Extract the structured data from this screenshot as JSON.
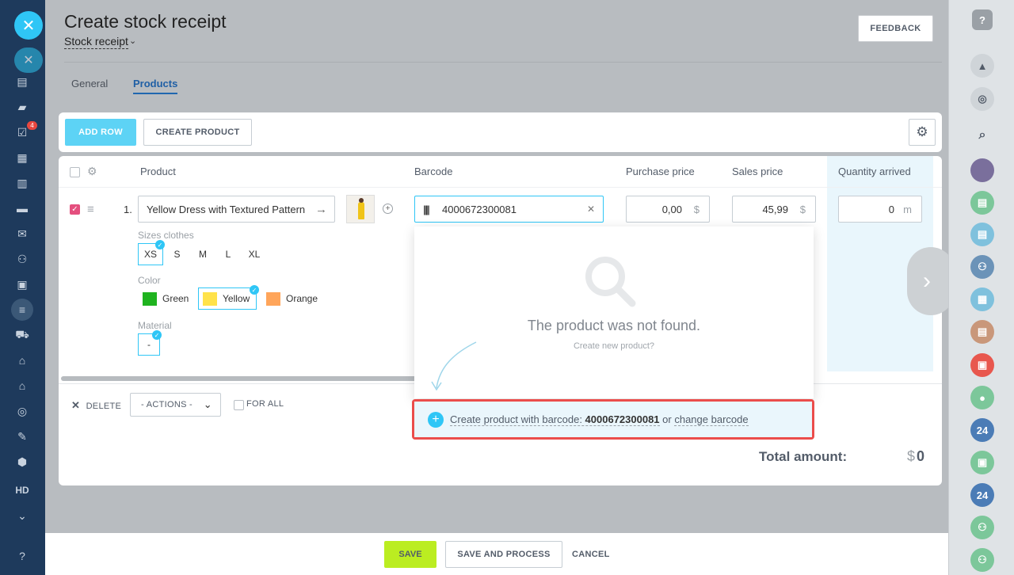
{
  "page": {
    "title": "Create stock receipt",
    "subtitle": "Stock receipt",
    "feedback_label": "FEEDBACK"
  },
  "tabs": [
    {
      "label": "General"
    },
    {
      "label": "Products"
    }
  ],
  "toolbar": {
    "add_row": "ADD ROW",
    "create_product": "CREATE PRODUCT"
  },
  "table": {
    "headers": [
      "Product",
      "Barcode",
      "Purchase price",
      "Sales price",
      "Quantity arrived"
    ],
    "row": {
      "number": "1.",
      "product": "Yellow Dress with Textured Pattern",
      "barcode": "4000672300081",
      "purchase_price": "0,00",
      "purchase_currency": "$",
      "sales_price": "45,99",
      "sales_currency": "$",
      "quantity": "0",
      "quantity_unit": "m"
    },
    "properties": {
      "sizes_label": "Sizes clothes",
      "sizes": [
        "XS",
        "S",
        "M",
        "L",
        "XL"
      ],
      "selected_size": "XS",
      "color_label": "Color",
      "colors": [
        {
          "name": "Green",
          "hex": "#1fb31f"
        },
        {
          "name": "Yellow",
          "hex": "#ffe24a"
        },
        {
          "name": "Orange",
          "hex": "#ffa55a"
        }
      ],
      "selected_color": "Yellow",
      "material_label": "Material",
      "material_value": "-"
    }
  },
  "footer": {
    "delete": "DELETE",
    "actions": "- ACTIONS -",
    "for_all": "FOR ALL",
    "total_label": "Total amount:",
    "total_currency": "$",
    "total_value": "0"
  },
  "popup": {
    "not_found": "The product was not found.",
    "create_new": "Create new product?",
    "create_prefix": "Create product with barcode: ",
    "create_barcode": "4000672300081",
    "create_or": " or ",
    "change_barcode": "change barcode"
  },
  "bottom": {
    "save": "SAVE",
    "save_and_process": "SAVE AND PROCESS",
    "cancel": "CANCEL"
  },
  "leftbar": {
    "badge": "4",
    "hd": "HD"
  },
  "rightbar": {
    "badge_24": "24"
  },
  "colors": {
    "accent": "#2fc6f6",
    "save": "#bbed21",
    "highlight_border": "#eb4d4b",
    "checkbox": "#e44f7e"
  }
}
